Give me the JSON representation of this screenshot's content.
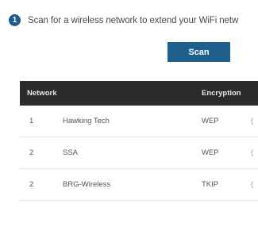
{
  "step": {
    "number": "1",
    "instruction": "Scan for a wireless network to extend your WiFi netw"
  },
  "scan_button": {
    "label": "Scan"
  },
  "table": {
    "columns": [
      "Network",
      "Encryption"
    ],
    "rows": [
      {
        "index": "1",
        "name": "Hawking Tech",
        "encryption": "WEP",
        "edge": "("
      },
      {
        "index": "2",
        "name": "SSA",
        "encryption": "WEP",
        "edge": "("
      },
      {
        "index": "2",
        "name": "BRG-Wireless",
        "encryption": "TKIP",
        "edge": "("
      },
      {
        "index": "",
        "name": "",
        "encryption": "",
        "edge": ""
      }
    ]
  },
  "colors": {
    "accent": "#1e5f8e",
    "header_bg": "#2b2b2b"
  },
  "icons": {
    "step_badge": "numbered-circle-icon"
  }
}
